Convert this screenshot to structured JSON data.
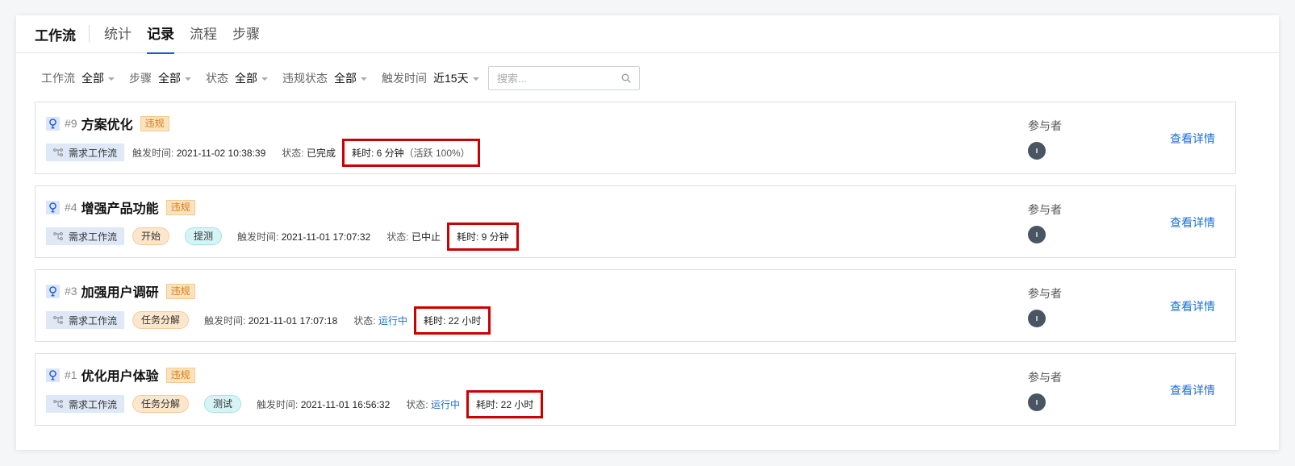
{
  "tabs": {
    "title": "工作流",
    "items": [
      "统计",
      "记录",
      "流程",
      "步骤"
    ],
    "active": "记录"
  },
  "filters": [
    {
      "label": "工作流",
      "value": "全部"
    },
    {
      "label": "步骤",
      "value": "全部"
    },
    {
      "label": "状态",
      "value": "全部"
    },
    {
      "label": "违规状态",
      "value": "全部"
    },
    {
      "label": "触发时间",
      "value": "近15天"
    }
  ],
  "search": {
    "placeholder": "搜索..."
  },
  "records": [
    {
      "number": "#9",
      "title": "方案优化",
      "violation_tag": "违规",
      "workflow_tag": "需求工作流",
      "pills": [],
      "trigger_label": "触发时间:",
      "trigger_time": "2021-11-02 10:38:39",
      "status_label": "状态:",
      "status": "已完成",
      "duration_label": "耗时:",
      "duration": "6 分钟",
      "active_pct": "（活跃 100%）",
      "participants_label": "参与者",
      "detail_link": "查看详情"
    },
    {
      "number": "#4",
      "title": "增强产品功能",
      "violation_tag": "违规",
      "workflow_tag": "需求工作流",
      "pills": [
        {
          "text": "开始",
          "color": "orange"
        },
        {
          "text": "提测",
          "color": "cyan"
        }
      ],
      "trigger_label": "触发时间:",
      "trigger_time": "2021-11-01 17:07:32",
      "status_label": "状态:",
      "status": "已中止",
      "duration_label": "耗时:",
      "duration": "9 分钟",
      "active_pct": "",
      "participants_label": "参与者",
      "detail_link": "查看详情"
    },
    {
      "number": "#3",
      "title": "加强用户调研",
      "violation_tag": "违规",
      "workflow_tag": "需求工作流",
      "pills": [
        {
          "text": "任务分解",
          "color": "orange"
        }
      ],
      "trigger_label": "触发时间:",
      "trigger_time": "2021-11-01 17:07:18",
      "status_label": "状态:",
      "status": "运行中",
      "duration_label": "耗时:",
      "duration": "22 小时",
      "active_pct": "",
      "participants_label": "参与者",
      "detail_link": "查看详情"
    },
    {
      "number": "#1",
      "title": "优化用户体验",
      "violation_tag": "违规",
      "workflow_tag": "需求工作流",
      "pills": [
        {
          "text": "任务分解",
          "color": "orange"
        },
        {
          "text": "测试",
          "color": "cyan"
        }
      ],
      "trigger_label": "触发时间:",
      "trigger_time": "2021-11-01 16:56:32",
      "status_label": "状态:",
      "status": "运行中",
      "duration_label": "耗时:",
      "duration": "22 小时",
      "active_pct": "",
      "participants_label": "参与者",
      "detail_link": "查看详情"
    }
  ],
  "colors": {
    "accent": "#1a56db",
    "link": "#1a6fd8",
    "highlight_box": "#cc0000",
    "violation_bg": "#fde3bd",
    "violation_text": "#d67b1a"
  },
  "icons": {
    "record": "lightbulb-icon",
    "workflow": "workflow-icon",
    "search": "search-icon",
    "avatar": "avatar"
  }
}
